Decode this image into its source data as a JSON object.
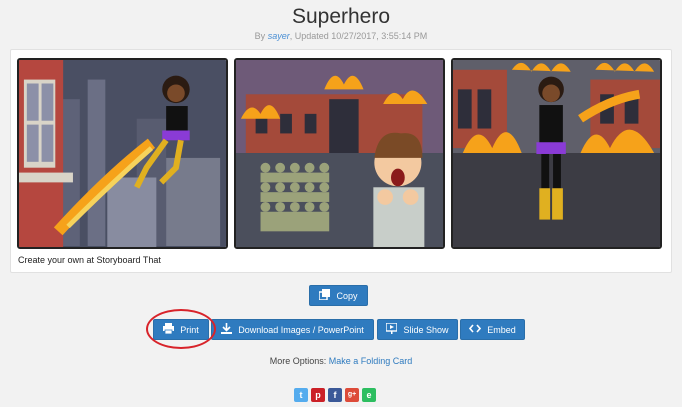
{
  "page": {
    "title": "Superhero"
  },
  "byline": {
    "prefix": "By ",
    "author": "sayer",
    "updated": ", Updated 10/27/2017, 3:55:14 PM"
  },
  "storyboard": {
    "caption": "Create your own at Storyboard That"
  },
  "actions": {
    "copy": "Copy",
    "print": "Print",
    "download": "Download Images / PowerPoint",
    "slideshow": "Slide Show",
    "embed": "Embed"
  },
  "more_options": {
    "label": "More Options: ",
    "link": "Make a Folding Card"
  },
  "social": [
    {
      "name": "twitter-icon",
      "glyph": "t",
      "color": "#55acee"
    },
    {
      "name": "pinterest-icon",
      "glyph": "p",
      "color": "#cb2027"
    },
    {
      "name": "facebook-icon",
      "glyph": "f",
      "color": "#3b5998"
    },
    {
      "name": "google-plus-icon",
      "glyph": "g+",
      "color": "#dd4b39"
    },
    {
      "name": "evernote-icon",
      "glyph": "e",
      "color": "#2dbe60"
    }
  ]
}
